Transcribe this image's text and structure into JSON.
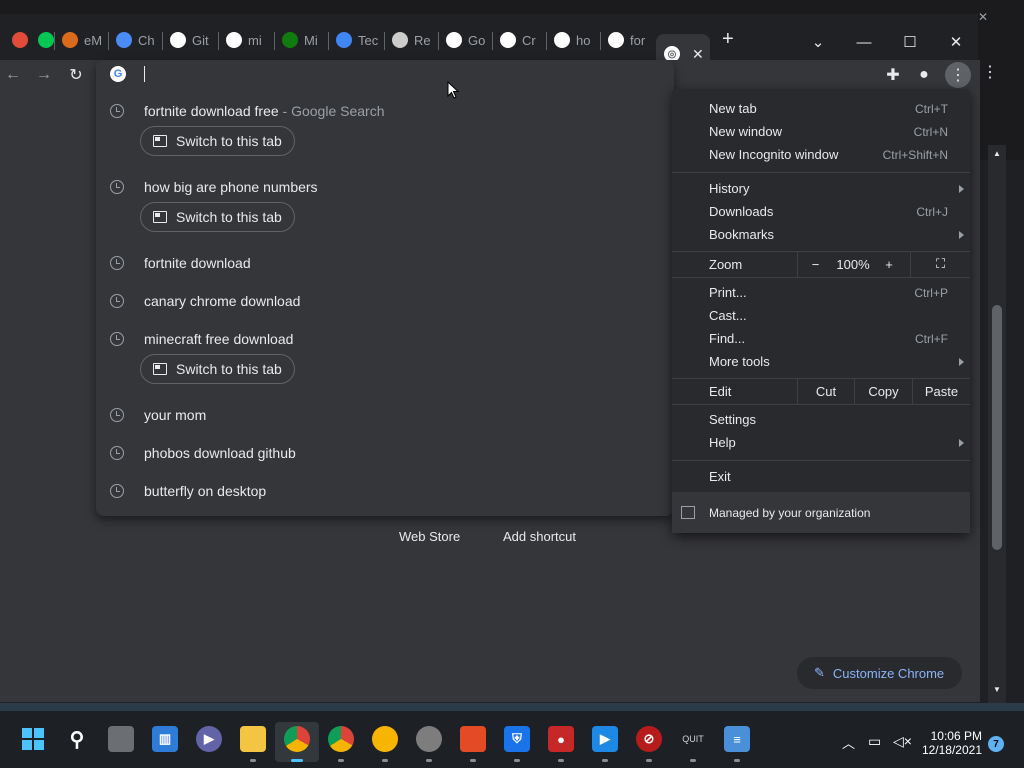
{
  "tabs": [
    {
      "title": "",
      "fav": "chrome-dev-icon",
      "color": "#e04b3a"
    },
    {
      "title": "",
      "fav": "green-check-icon",
      "color": "#00c853"
    },
    {
      "title": "eM",
      "fav": "firefox-icon",
      "color": "#d86b1c"
    },
    {
      "title": "Ch",
      "fav": "chrome-icon",
      "color": "#4b8bf5"
    },
    {
      "title": "Git",
      "fav": "github-icon",
      "color": "#ffffff"
    },
    {
      "title": "mi",
      "fav": "google-icon",
      "color": "#ffffff"
    },
    {
      "title": "Mi",
      "fav": "xbox-icon",
      "color": "#107c10"
    },
    {
      "title": "Tec",
      "fav": "drive-icon",
      "color": "#4285f4"
    },
    {
      "title": "Re",
      "fav": "doc-icon",
      "color": "#cccccc"
    },
    {
      "title": "Go",
      "fav": "google-icon",
      "color": "#ffffff"
    },
    {
      "title": "Cr",
      "fav": "google-icon",
      "color": "#ffffff"
    },
    {
      "title": "ho",
      "fav": "google-icon",
      "color": "#ffffff"
    },
    {
      "title": "for",
      "fav": "google-icon",
      "color": "#ffffff"
    }
  ],
  "new_tab_symbol": "+",
  "omnibox": {
    "input_value": "",
    "suggestions": [
      {
        "text": "fortnite download free",
        "suffix": " - Google Search",
        "switch": true
      },
      {
        "text": "how big are phone numbers",
        "suffix": "",
        "switch": true
      },
      {
        "text": "fortnite download",
        "suffix": "",
        "switch": false
      },
      {
        "text": "canary chrome download",
        "suffix": "",
        "switch": false
      },
      {
        "text": "minecraft free download",
        "suffix": "",
        "switch": true
      },
      {
        "text": "your mom",
        "suffix": "",
        "switch": false
      },
      {
        "text": "phobos download github",
        "suffix": "",
        "switch": false
      },
      {
        "text": "butterfly on desktop",
        "suffix": "",
        "switch": false
      }
    ],
    "switch_label": "Switch to this tab"
  },
  "menu": {
    "new_tab": {
      "label": "New tab",
      "shortcut": "Ctrl+T"
    },
    "new_window": {
      "label": "New window",
      "shortcut": "Ctrl+N"
    },
    "new_incognito": {
      "label": "New Incognito window",
      "shortcut": "Ctrl+Shift+N"
    },
    "history": {
      "label": "History"
    },
    "downloads": {
      "label": "Downloads",
      "shortcut": "Ctrl+J"
    },
    "bookmarks": {
      "label": "Bookmarks"
    },
    "zoom": {
      "label": "Zoom",
      "minus": "−",
      "value": "100%",
      "plus": "+"
    },
    "print": {
      "label": "Print...",
      "shortcut": "Ctrl+P"
    },
    "cast": {
      "label": "Cast..."
    },
    "find": {
      "label": "Find...",
      "shortcut": "Ctrl+F"
    },
    "more_tools": {
      "label": "More tools"
    },
    "edit": {
      "label": "Edit",
      "cut": "Cut",
      "copy": "Copy",
      "paste": "Paste"
    },
    "settings": {
      "label": "Settings"
    },
    "help": {
      "label": "Help"
    },
    "exit": {
      "label": "Exit"
    },
    "managed": {
      "label": "Managed by your organization"
    }
  },
  "ntp": {
    "web_store": "Web Store",
    "add_shortcut": "Add shortcut",
    "customize": "Customize Chrome"
  },
  "taskbar": {
    "quit_label": "QUIT",
    "time": "10:06 PM",
    "date": "12/18/2021",
    "notifications": "7"
  }
}
